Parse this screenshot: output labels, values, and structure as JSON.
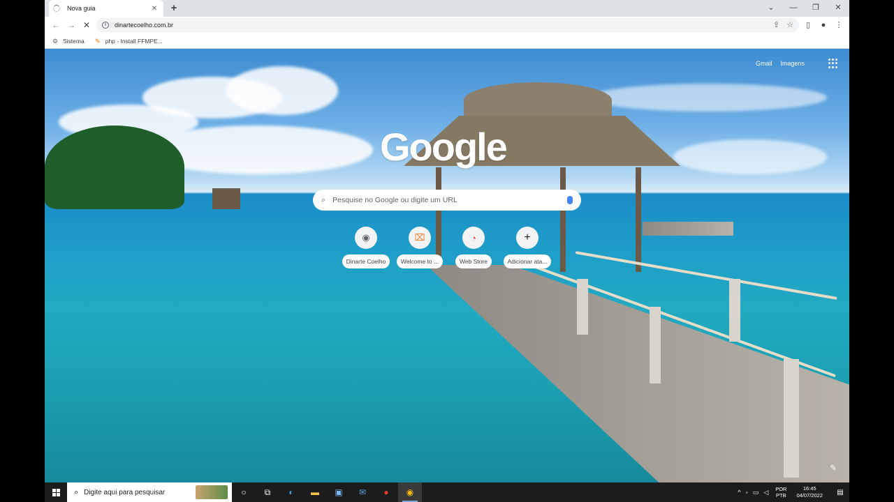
{
  "browser": {
    "tab_title": "Nova guia",
    "tab_close": "✕",
    "new_tab": "+",
    "url": "dinartecoelho.com.br",
    "window_controls": {
      "dropdown": "⌄",
      "minimize": "—",
      "restore": "❐",
      "close": "✕"
    },
    "nav": {
      "back": "←",
      "forward": "→",
      "reload": "✕"
    }
  },
  "bookmarks": [
    {
      "label": "Sistema",
      "icon": "gear-icon"
    },
    {
      "label": "php - Install FFMPE...",
      "icon": "php-icon"
    }
  ],
  "newtab_page": {
    "links": [
      "Gmail",
      "Imagens"
    ],
    "logo": "Google",
    "search_placeholder": "Pesquise no Google ou digite um URL",
    "shortcuts": [
      {
        "label": "Dinarte Coelho",
        "icon": "◉"
      },
      {
        "label": "Welcome to ...",
        "icon": "⌧"
      },
      {
        "label": "Web Store",
        "icon": "◔"
      },
      {
        "label": "Adicionar ata...",
        "icon": "+"
      }
    ]
  },
  "taskbar": {
    "search_text": "Digite aqui para pesquisar",
    "lang_line1": "POR",
    "lang_line2": "PTB",
    "time": "16:45",
    "date": "04/07/2022"
  },
  "colors": {
    "accent": "#4285f4",
    "taskbar": "#1c1c1c",
    "tabstrip": "#dee1e6"
  }
}
